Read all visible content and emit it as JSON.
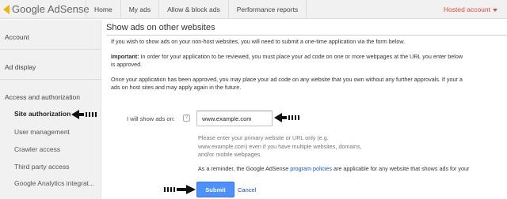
{
  "header": {
    "logo_google": "Google",
    "logo_product": "AdSense",
    "nav": [
      "Home",
      "My ads",
      "Allow & block ads",
      "Performance reports"
    ],
    "account": "Hosted account"
  },
  "sidebar": {
    "items": [
      {
        "label": "Account"
      },
      {
        "label": "Ad display"
      },
      {
        "label": "Access and authorization"
      },
      {
        "label": "Site authorization"
      },
      {
        "label": "User management"
      },
      {
        "label": "Crawler access"
      },
      {
        "label": "Third party access"
      },
      {
        "label": "Google Analytics integrat..."
      }
    ]
  },
  "main": {
    "title": "Show ads on other websites",
    "intro": "If you wish to show ads on your non-host websites, you will need to submit a one-time application via the form below.",
    "important_label": "Important:",
    "important_text": " In order for your application to be reviewed, you must place your ad code on one or more webpages at the URL you enter below",
    "important_text2": "is approved.",
    "approved_line1": "Once your application has been approved, you may place your ad code on any website that you own without any further approvals. If your a",
    "approved_line2": "ads on host sites and may apply again in the future.",
    "form": {
      "label": "I will show ads on:",
      "help_icon": "?",
      "url_value": "www.example.com",
      "hint_line1": "Please enter your primary website or URL only (e.g.",
      "hint_line2": "www.example.com) even if you have multiple websites, domains,",
      "hint_line3": "and/or mobile webpages."
    },
    "reminder_before": "As a reminder, the Google AdSense ",
    "reminder_link": "program policies",
    "reminder_after": " are applicable for any website that shows ads for your",
    "submit_label": "Submit",
    "cancel_label": "Cancel"
  },
  "colors": {
    "accent": "#4d90fe",
    "link": "#1155cc",
    "account_red": "#dd4b39",
    "logo_yellow": "#f4b400"
  }
}
